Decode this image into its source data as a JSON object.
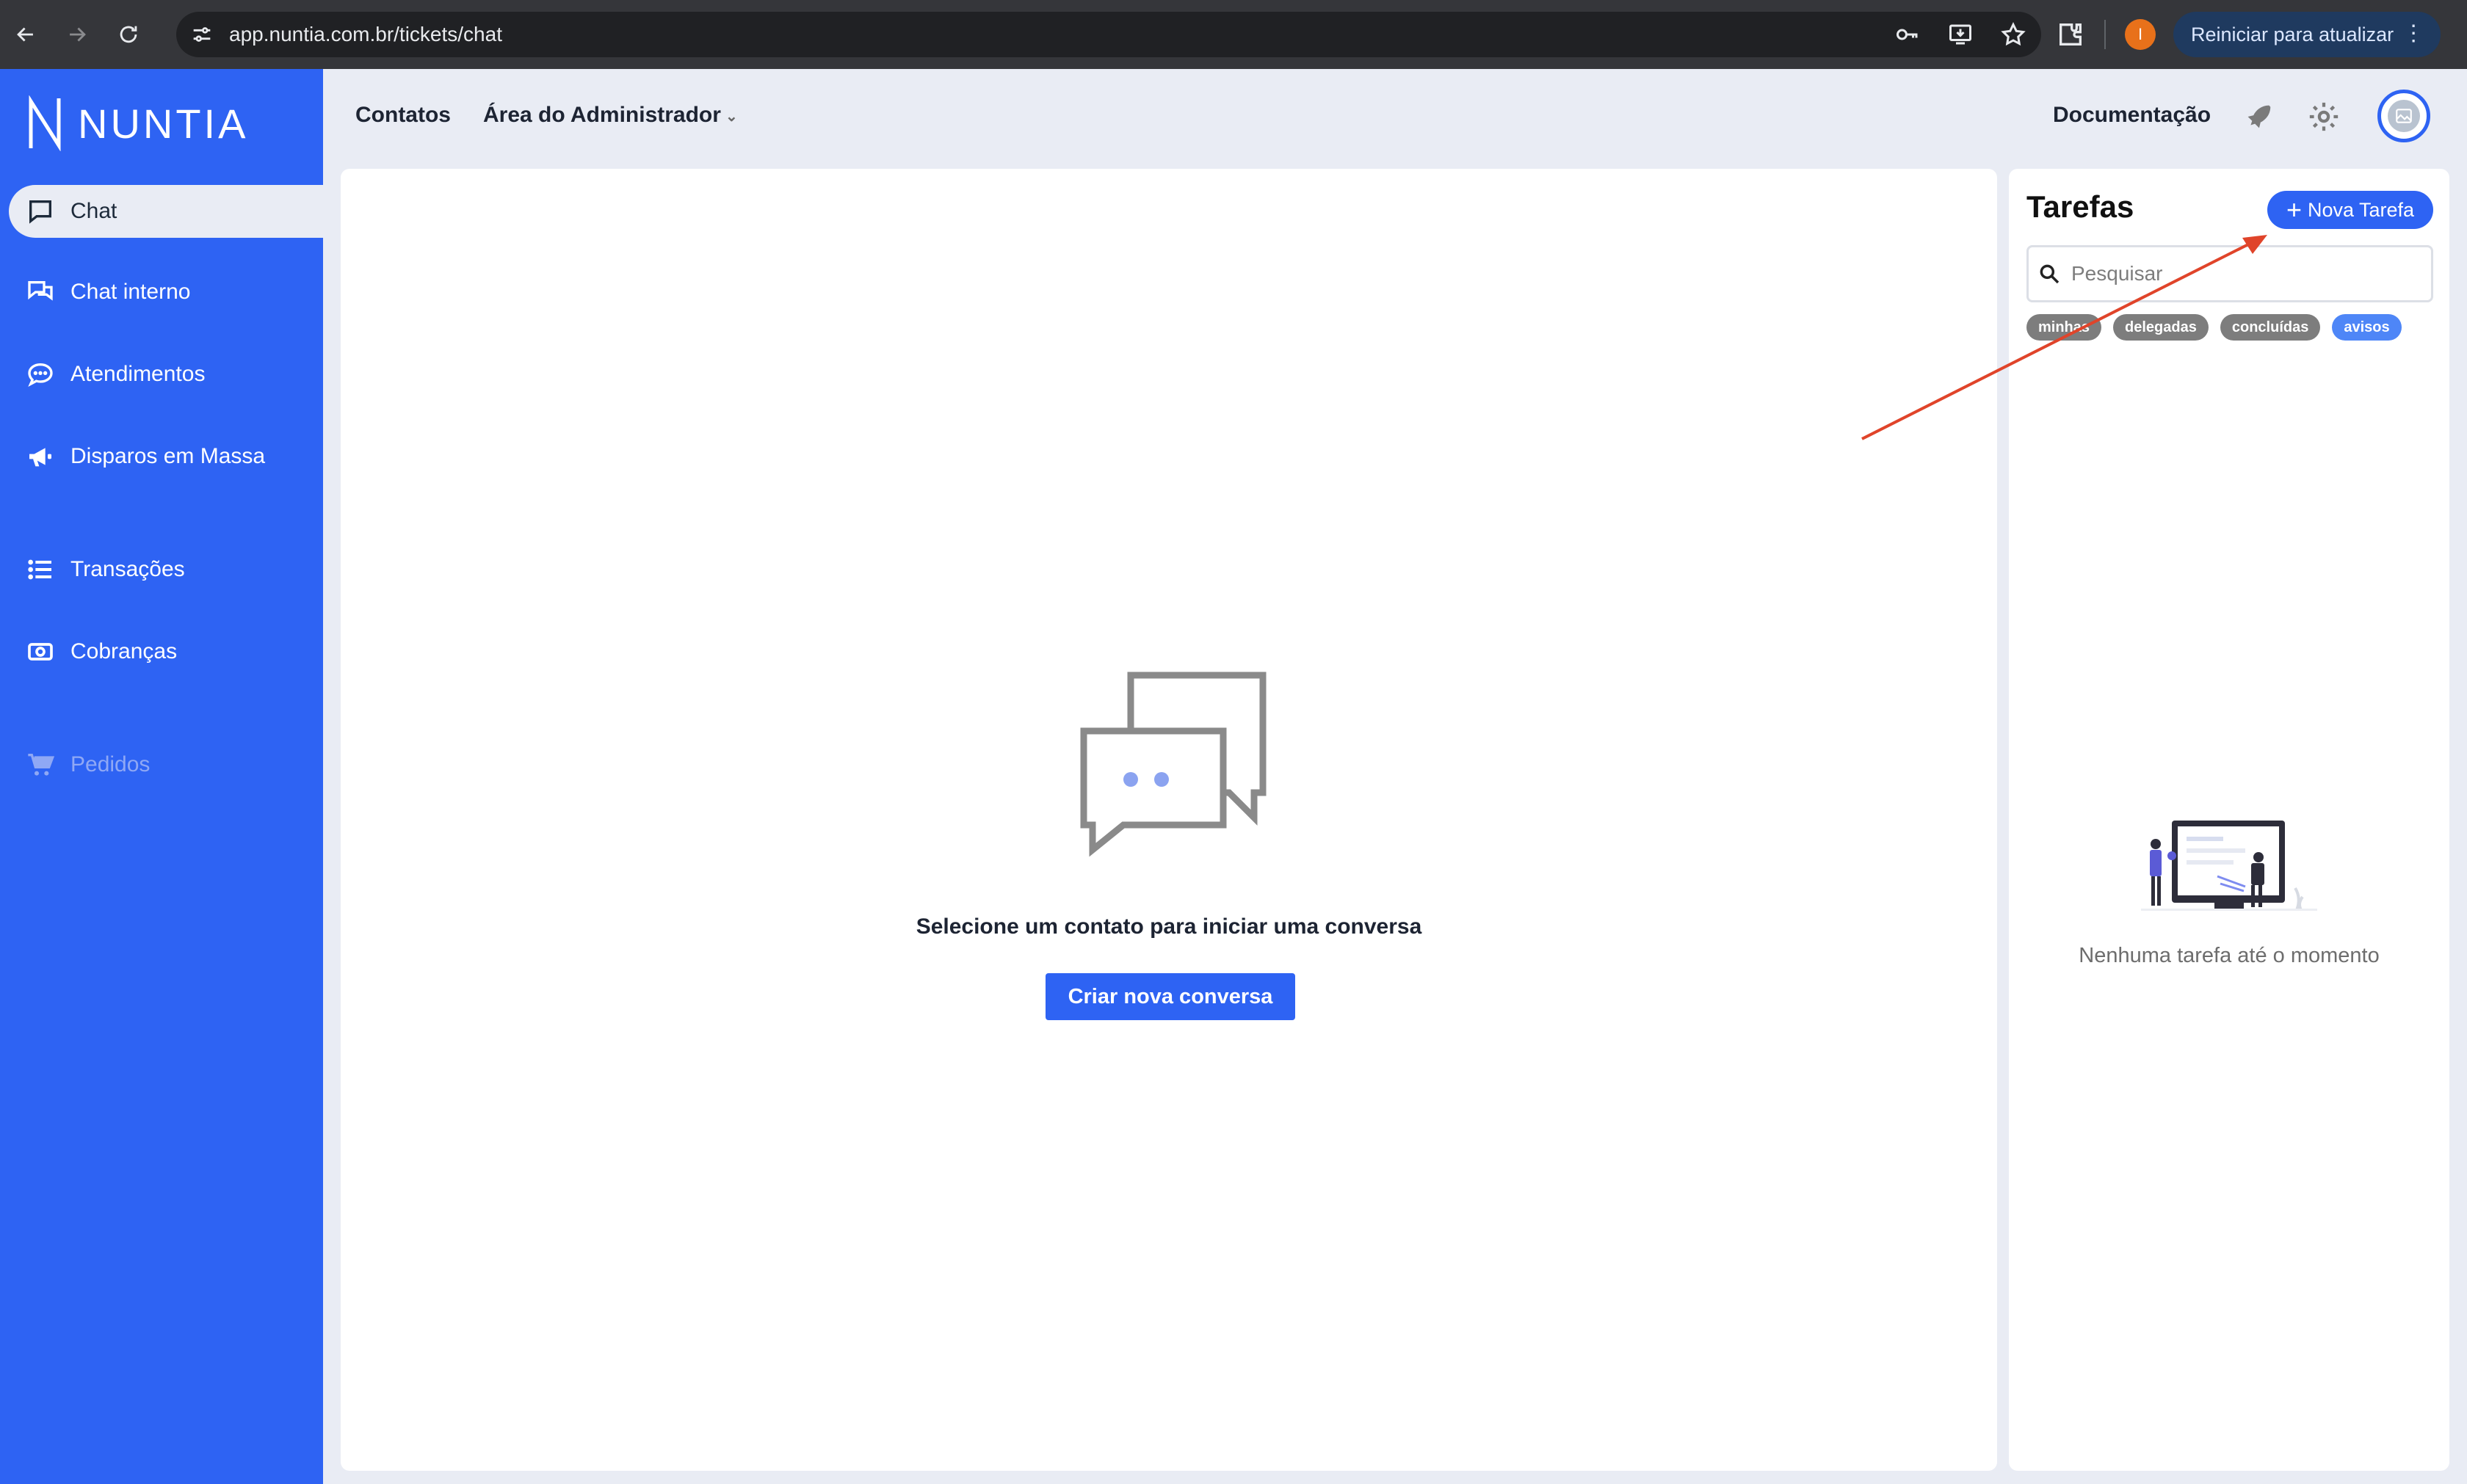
{
  "browser": {
    "url": "app.nuntia.com.br/tickets/chat",
    "profile_initial": "I",
    "update_label": "Reiniciar para atualizar"
  },
  "sidebar": {
    "brand": "NUNTIA",
    "items": [
      {
        "label": "Chat",
        "icon": "chat-bubble-icon"
      },
      {
        "label": "Chat interno",
        "icon": "chat-bubbles-icon"
      },
      {
        "label": "Atendimentos",
        "icon": "chat-dots-icon"
      },
      {
        "label": "Disparos em Massa",
        "icon": "megaphone-icon"
      },
      {
        "label": "Transações",
        "icon": "list-icon"
      },
      {
        "label": "Cobranças",
        "icon": "money-icon"
      },
      {
        "label": "Pedidos",
        "icon": "cart-icon"
      }
    ]
  },
  "header": {
    "contacts": "Contatos",
    "admin": "Área do Administrador",
    "docs": "Documentação"
  },
  "main": {
    "empty_message": "Selecione um contato para iniciar uma conversa",
    "create_button": "Criar nova conversa"
  },
  "tasks": {
    "title": "Tarefas",
    "new_task": "Nova Tarefa",
    "search_placeholder": "Pesquisar",
    "filters": [
      "minhas",
      "delegadas",
      "concluídas",
      "avisos"
    ],
    "active_filter": "avisos",
    "empty_message": "Nenhuma tarefa até o momento"
  },
  "colors": {
    "primary": "#2e63f3",
    "annotation_arrow": "#e0442a"
  }
}
